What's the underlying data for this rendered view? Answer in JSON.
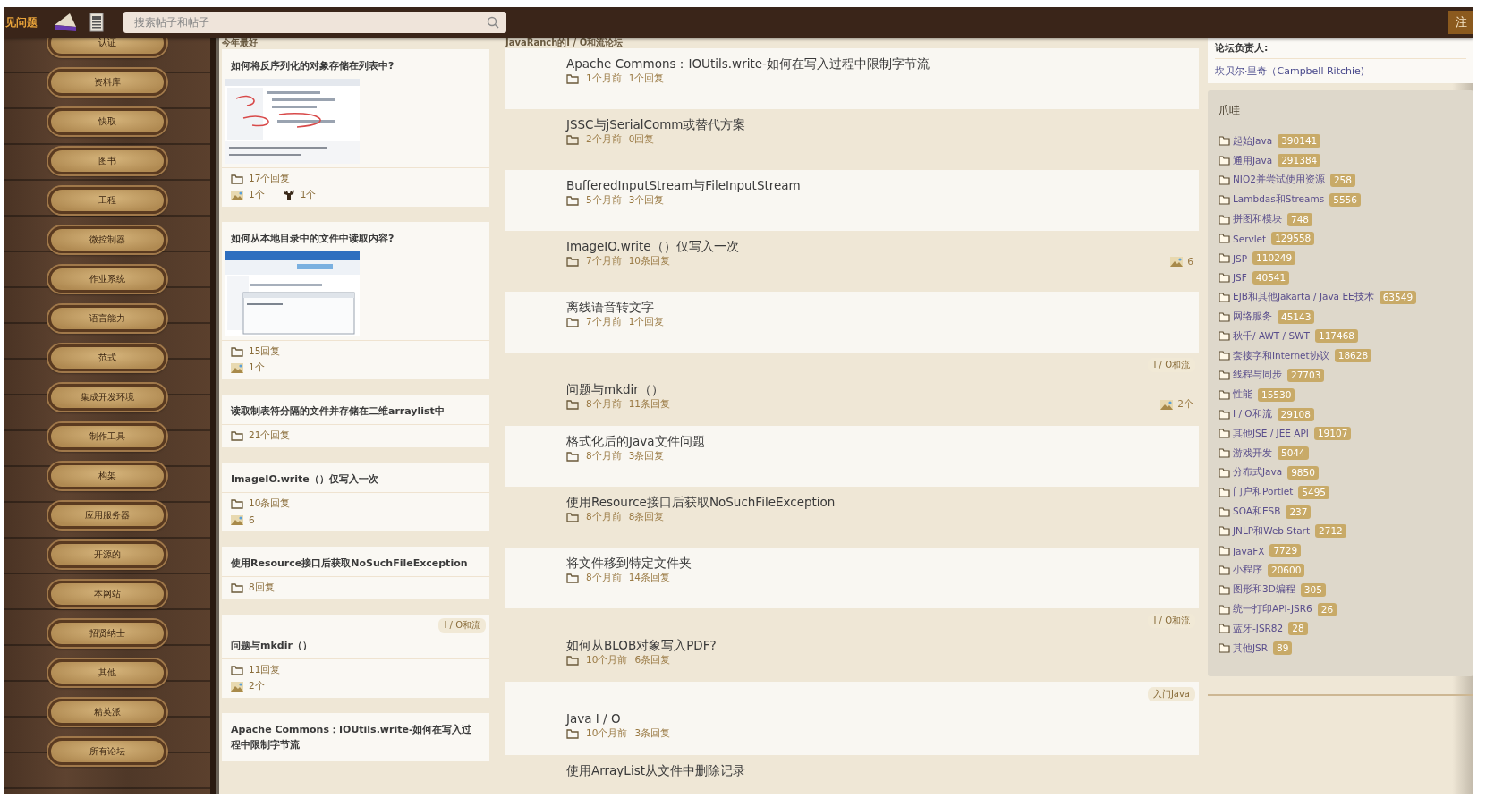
{
  "header": {
    "faq_link": "见问题",
    "search": {
      "placeholder": "搜索帖子和帖子"
    },
    "register_button": "注"
  },
  "sidebar": {
    "buttons": [
      "认证",
      "资料库",
      "快取",
      "图书",
      "工程",
      "微控制器",
      "作业系统",
      "语言能力",
      "范式",
      "集成开发环境",
      "制作工具",
      "构架",
      "应用服务器",
      "开源的",
      "本网站",
      "招贤纳士",
      "其他",
      "精英派",
      "所有论坛"
    ]
  },
  "best_of_year": {
    "heading": "今年最好",
    "posts": [
      {
        "title": "如何将反序列化的对象存储在列表中?",
        "replies": "17个回复",
        "images": "1个",
        "moose": "1个"
      },
      {
        "title": "如何从本地目录中的文件中读取内容?",
        "replies": "15回复",
        "images": "1个"
      },
      {
        "title": "读取制表符分隔的文件并存储在二维arraylist中",
        "replies": "21个回复"
      },
      {
        "title": "ImageIO.write（）仅写入一次",
        "replies": "10条回复",
        "images": "6"
      },
      {
        "title": "使用Resource接口后获取NoSuchFileException",
        "replies": "8回复"
      },
      {
        "title": "问题与mkdir（）",
        "tag": "I / O和流",
        "replies": "11回复",
        "images": "2个"
      },
      {
        "title": "Apache Commons：IOUtils.write-如何在写入过程中限制字节流"
      }
    ]
  },
  "forum": {
    "heading": "JavaRanch的I / O和流论坛",
    "topics": [
      {
        "title": "Apache Commons：IOUtils.write-如何在写入过程中限制字节流",
        "age": "1个月前",
        "replies": "1个回复"
      },
      {
        "title": "JSSC与jSerialComm或替代方案",
        "age": "2个月前",
        "replies": "0回复"
      },
      {
        "title": "BufferedInputStream与FileInputStream",
        "age": "5个月前",
        "replies": "3个回复"
      },
      {
        "title": "ImageIO.write（）仅写入一次",
        "age": "7个月前",
        "replies": "10条回复",
        "images": "6"
      },
      {
        "title": "离线语音转文字",
        "age": "7个月前",
        "replies": "1个回复"
      },
      {
        "title": "问题与mkdir（）",
        "tag": "I / O和流",
        "age": "8个月前",
        "replies": "11条回复",
        "images": "2个"
      },
      {
        "title": "格式化后的Java文件问题",
        "age": "8个月前",
        "replies": "3条回复"
      },
      {
        "title": "使用Resource接口后获取NoSuchFileException",
        "age": "8个月前",
        "replies": "8条回复"
      },
      {
        "title": "将文件移到特定文件夹",
        "age": "8个月前",
        "replies": "14条回复"
      },
      {
        "title": "如何从BLOB对象写入PDF?",
        "tag": "I / O和流",
        "age": "10个月前",
        "replies": "6条回复"
      },
      {
        "title": "Java I / O",
        "tag": "入门Java",
        "age": "10个月前",
        "replies": "3条回复"
      },
      {
        "title": "使用ArrayList从文件中删除记录"
      }
    ]
  },
  "staff": {
    "heading": "论坛负责人:",
    "moderators": [
      "坎贝尔·里奇（Campbell Ritchie)"
    ]
  },
  "category": {
    "heading": "爪哇",
    "forums": [
      {
        "name": "起始Java",
        "count": "390141"
      },
      {
        "name": "通用Java",
        "count": "291384"
      },
      {
        "name": "NIO2并尝试使用资源",
        "count": "258"
      },
      {
        "name": "Lambdas和Streams",
        "count": "5556"
      },
      {
        "name": "拼图和模块",
        "count": "748"
      },
      {
        "name": "Servlet",
        "count": "129558"
      },
      {
        "name": "JSP",
        "count": "110249"
      },
      {
        "name": "JSF",
        "count": "40541"
      },
      {
        "name": "EJB和其他Jakarta / Java EE技术",
        "count": "63549"
      },
      {
        "name": "网络服务",
        "count": "45143"
      },
      {
        "name": "秋千/ AWT / SWT",
        "count": "117468"
      },
      {
        "name": "套接字和Internet协议",
        "count": "18628"
      },
      {
        "name": "线程与同步",
        "count": "27703"
      },
      {
        "name": "性能",
        "count": "15530"
      },
      {
        "name": "I / O和流",
        "count": "29108"
      },
      {
        "name": "其他JSE / JEE API",
        "count": "19107"
      },
      {
        "name": "游戏开发",
        "count": "5044"
      },
      {
        "name": "分布式Java",
        "count": "9850"
      },
      {
        "name": "门户和Portlet",
        "count": "5495"
      },
      {
        "name": "SOA和ESB",
        "count": "237"
      },
      {
        "name": "JNLP和Web Start",
        "count": "2712"
      },
      {
        "name": "JavaFX",
        "count": "7729"
      },
      {
        "name": "小程序",
        "count": "20600"
      },
      {
        "name": "图形和3D编程",
        "count": "305"
      },
      {
        "name": "统一打印API-JSR6",
        "count": "26"
      },
      {
        "name": "蓝牙-JSR82",
        "count": "28"
      },
      {
        "name": "其他JSR",
        "count": "89"
      }
    ]
  }
}
